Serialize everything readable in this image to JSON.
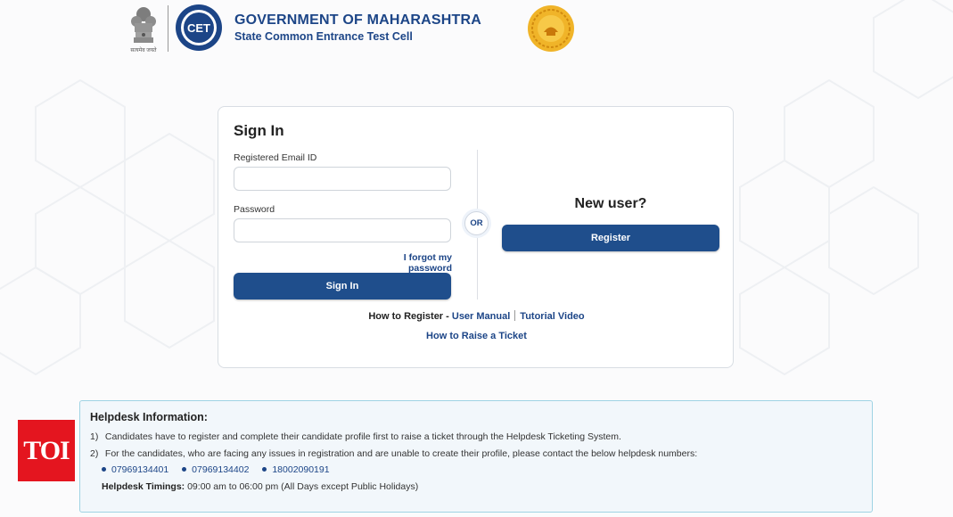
{
  "header": {
    "emblem_caption": "सत्यमेव जयते",
    "cet_logo_text": "CET",
    "org_title": "GOVERNMENT OF MAHARASHTRA",
    "org_subtitle": "State Common Entrance Test Cell",
    "colors": {
      "brand_blue": "#1c4587",
      "seal_gold": "#f0b429"
    }
  },
  "signin": {
    "title": "Sign In",
    "email_label": "Registered Email ID",
    "email_value": "",
    "password_label": "Password",
    "password_value": "",
    "forgot_link": "I forgot my password",
    "signin_button": "Sign In",
    "or_label": "OR",
    "new_user_heading": "New user?",
    "register_button": "Register",
    "how_to_register_prefix": "How to Register -",
    "user_manual_link": "User Manual",
    "tutorial_video_link": "Tutorial Video",
    "raise_ticket_link": "How to Raise a Ticket",
    "button_color": "#1f4e8c"
  },
  "helpdesk": {
    "title": "Helpdesk Information:",
    "items": [
      {
        "number": "1)",
        "text": "Candidates have to register and complete their candidate profile first to raise a ticket through the Helpdesk Ticketing System."
      },
      {
        "number": "2)",
        "text": "For the candidates, who are facing any issues in registration and are unable to create their profile, please contact the below helpdesk numbers:"
      }
    ],
    "phones": [
      "07969134401",
      "07969134402",
      "18002090191"
    ],
    "timings_label": "Helpdesk Timings:",
    "timings_value": "09:00 am to 06:00 pm (All Days except Public Holidays)"
  },
  "watermark": {
    "text": "TOI",
    "color": "#e4151f"
  }
}
